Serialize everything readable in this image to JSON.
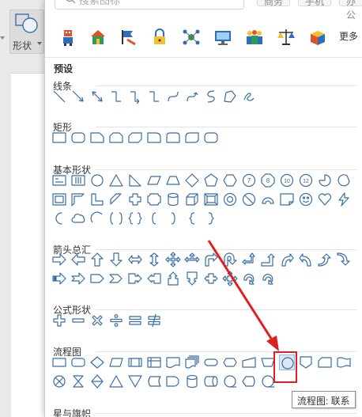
{
  "toolbar": {
    "shape_label": "形状"
  },
  "search": {
    "placeholder": "搜索图标"
  },
  "top_tabs": [
    "商务",
    "手机",
    "办公"
  ],
  "library_icons": [
    "robot-icon",
    "house-icon",
    "flag-icon",
    "lock-icon",
    "network-icon",
    "monitor-icon",
    "team-icon",
    "balance-icon",
    "package-icon"
  ],
  "more_label": "更多",
  "preset_title": "预设",
  "categories": {
    "lines": "线条",
    "rectangles": "矩形",
    "basic": "基本形状",
    "arrows": "箭头总汇",
    "formula": "公式形状",
    "flowchart": "流程图",
    "stars": "星与旗帜"
  },
  "tooltip": "流程图: 联系",
  "colors": {
    "accent": "#2a6ebd",
    "annotation": "#e02020"
  }
}
